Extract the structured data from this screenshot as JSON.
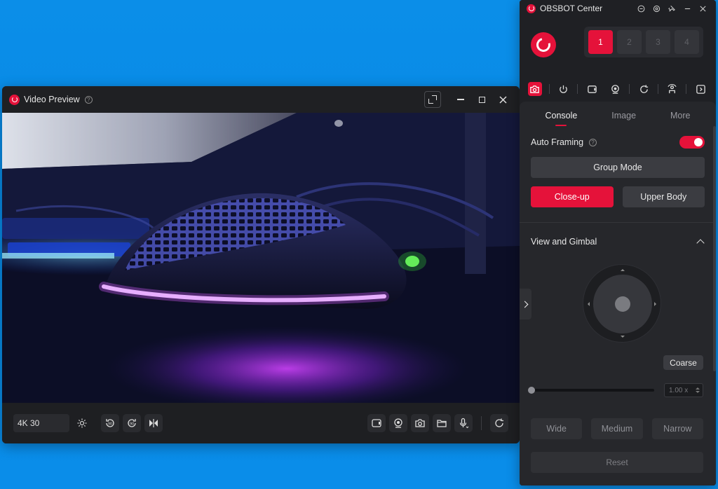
{
  "video_preview": {
    "title": "Video Preview",
    "help_glyph": "?",
    "resolution": "4K 30",
    "icons": [
      "expand-icon",
      "minimize-icon",
      "maximize-icon",
      "close-icon",
      "settings-icon",
      "rotate-left-90-icon",
      "rotate-right-90-icon",
      "mirror-flip-icon",
      "record-video-icon",
      "webcam-icon",
      "snapshot-camera-icon",
      "folder-icon",
      "microphone-icon",
      "refresh-ai-icon"
    ],
    "rotate_left_label": "90",
    "rotate_right_label": "90"
  },
  "obsbot_center": {
    "title": "OBSBOT Center",
    "device_slots": [
      "1",
      "2",
      "3",
      "4"
    ],
    "active_slot": "1",
    "toolbar_icons": [
      "camera-settings-icon",
      "power-icon",
      "video-icon",
      "webcam-icon",
      "sync-icon",
      "tracking-icon",
      "sidebar-toggle-icon"
    ],
    "tabs": [
      {
        "label": "Console",
        "active": true
      },
      {
        "label": "Image",
        "active": false
      },
      {
        "label": "More",
        "active": false
      }
    ],
    "auto_framing": {
      "label": "Auto Framing",
      "help_glyph": "?",
      "enabled": true
    },
    "group_mode_label": "Group Mode",
    "framing_options": [
      {
        "label": "Close-up",
        "selected": true
      },
      {
        "label": "Upper Body",
        "selected": false
      }
    ],
    "view_gimbal": {
      "title": "View and Gimbal",
      "coarse_label": "Coarse",
      "zoom_value": "1.00 x",
      "zoom_level": 0,
      "presets": [
        "Wide",
        "Medium",
        "Narrow"
      ],
      "reset_label": "Reset"
    }
  },
  "colors": {
    "accent": "#e5123a",
    "panel": "#26272b",
    "window": "#1f2024",
    "desktop": "#0b8ee8"
  }
}
